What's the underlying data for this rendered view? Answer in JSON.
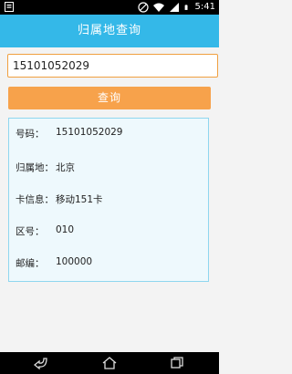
{
  "status_bar": {
    "time": "5:41",
    "icons": [
      "notification-icon",
      "mute-icon",
      "wifi-icon",
      "signal-icon",
      "battery-icon"
    ]
  },
  "header": {
    "title": "归属地查询"
  },
  "search": {
    "value": "15101052029"
  },
  "query_button": {
    "label": "查询"
  },
  "result": {
    "number_label": "号码：",
    "number_value": "15101052029",
    "location_label": "归属地：",
    "location_value": "北京",
    "card_label": "卡信息：",
    "card_value": "移动151卡",
    "area_code_label": "区号：",
    "area_code_value": "010",
    "postcode_label": "邮编：",
    "postcode_value": "100000"
  },
  "nav_bar": {
    "icons": [
      "back-icon",
      "home-icon",
      "recents-icon"
    ]
  },
  "colors": {
    "title_bar": "#34b8e8",
    "button": "#f7a24b",
    "input_border": "#f0a040",
    "panel_border": "#8fd6ef",
    "panel_bg": "#eef9fd"
  }
}
